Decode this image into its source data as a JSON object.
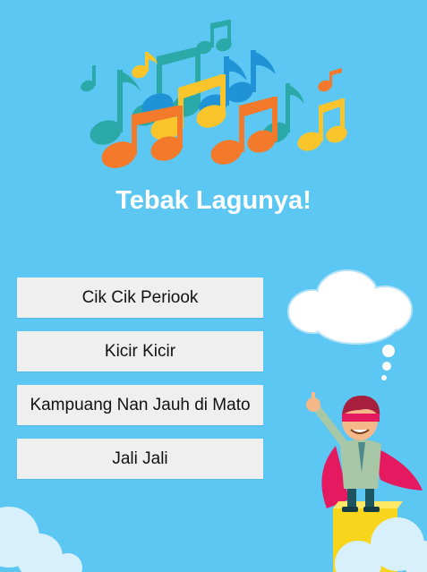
{
  "app": {
    "title": "Tebak Lagunya!"
  },
  "answers": [
    {
      "label": "Cik Cik Periook"
    },
    {
      "label": "Kicir Kicir"
    },
    {
      "label": "Kampuang Nan Jauh di Mato"
    },
    {
      "label": "Jali Jali"
    }
  ],
  "colors": {
    "background": "#5cc7f3",
    "button": "#efefef",
    "note_orange": "#f27a2a",
    "note_yellow": "#f9c52a",
    "note_teal": "#2aa9a8",
    "note_blue": "#1f93d6"
  },
  "icons": {
    "logo": "music-notes-icon",
    "cloud": "thought-cloud-icon",
    "hero": "superhero-character"
  }
}
